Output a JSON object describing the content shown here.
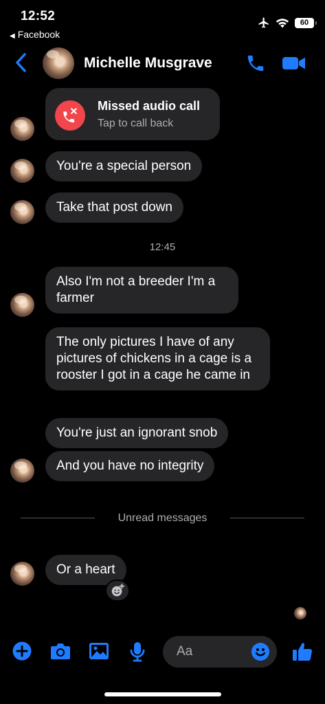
{
  "status_bar": {
    "time": "12:52",
    "back_app": "Facebook",
    "battery": "60"
  },
  "header": {
    "contact_name": "Michelle Musgrave"
  },
  "missed_call": {
    "title": "Missed audio call",
    "subtitle": "Tap to call back"
  },
  "messages": [
    {
      "text": "You're a special person"
    },
    {
      "text": "Take that post down"
    },
    {
      "text": "Also I'm not a breeder I'm a farmer"
    },
    {
      "text": "The only pictures I have of any pictures of chickens in a cage is a rooster I got in a cage he came in"
    },
    {
      "text": "You're just an ignorant snob"
    },
    {
      "text": "And you have no integrity"
    },
    {
      "text": "Or a heart"
    }
  ],
  "timestamp": "12:45",
  "unread_divider": "Unread messages",
  "composer": {
    "placeholder": "Aa"
  },
  "icons": {
    "back": "chevron-left-icon",
    "call": "phone-icon",
    "video": "video-camera-icon",
    "add": "plus-icon",
    "camera": "camera-icon",
    "gallery": "image-icon",
    "mic": "microphone-icon",
    "emoji": "smiley-icon",
    "like": "thumbs-up-icon",
    "add_reaction": "add-reaction-icon"
  },
  "colors": {
    "accent": "#1f7cff",
    "bubble": "#262628",
    "missed_call": "#f0464c"
  }
}
